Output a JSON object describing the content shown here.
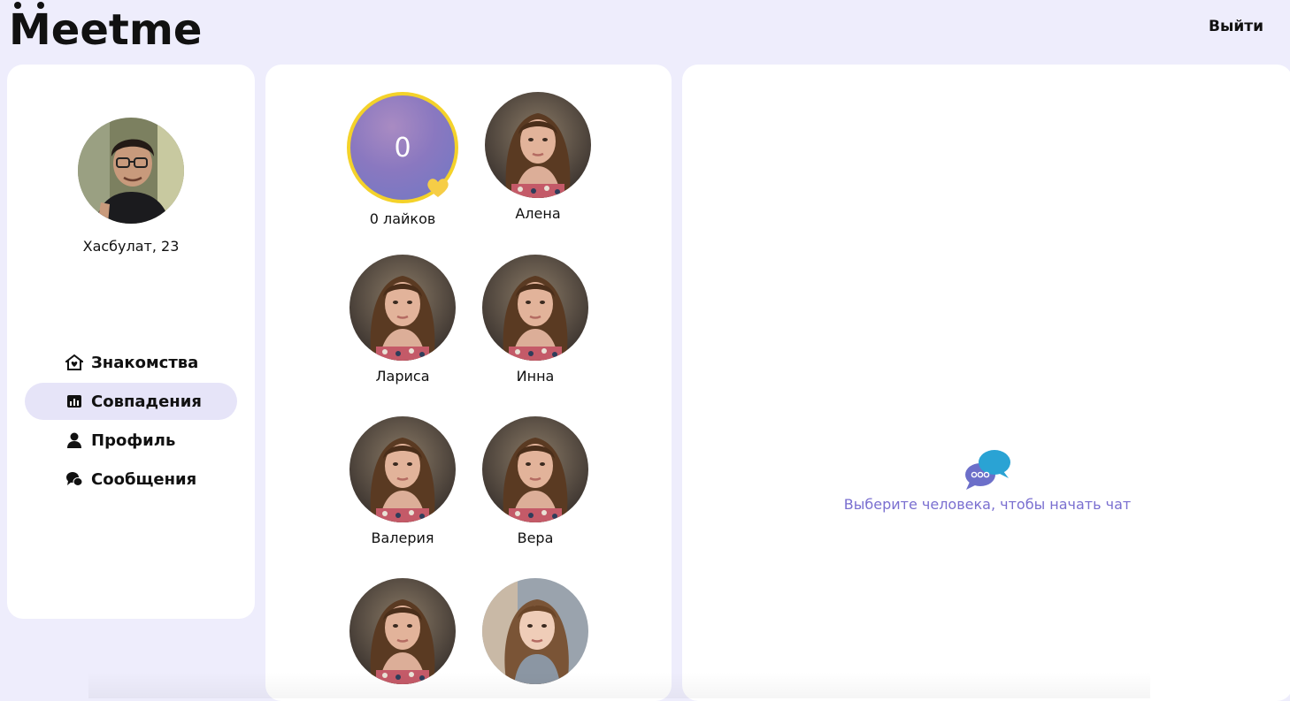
{
  "app": {
    "logo": "Meetme",
    "logout_label": "Выйти"
  },
  "user": {
    "name_age": "Хасбулат, 23"
  },
  "nav": [
    {
      "label": "Знакомства",
      "icon": "home-heart-icon",
      "active": false
    },
    {
      "label": "Совпадения",
      "icon": "chart-icon",
      "active": true
    },
    {
      "label": "Профиль",
      "icon": "user-icon",
      "active": false
    },
    {
      "label": "Сообщения",
      "icon": "chat-icon",
      "active": false
    }
  ],
  "likes": {
    "count": "0",
    "label": "0 лайков"
  },
  "matches": [
    {
      "name": "Алена"
    },
    {
      "name": "Лариса"
    },
    {
      "name": "Инна"
    },
    {
      "name": "Валерия"
    },
    {
      "name": "Вера"
    },
    {
      "name": ""
    },
    {
      "name": ""
    }
  ],
  "chat": {
    "empty_hint": "Выберите человека, чтобы начать чат",
    "icon": "chat-bubbles-icon"
  },
  "colors": {
    "background": "#eeedfc",
    "accent": "#7a6fd0",
    "active_nav": "#e6e4f8",
    "likes_ring": "#f4d22a"
  }
}
